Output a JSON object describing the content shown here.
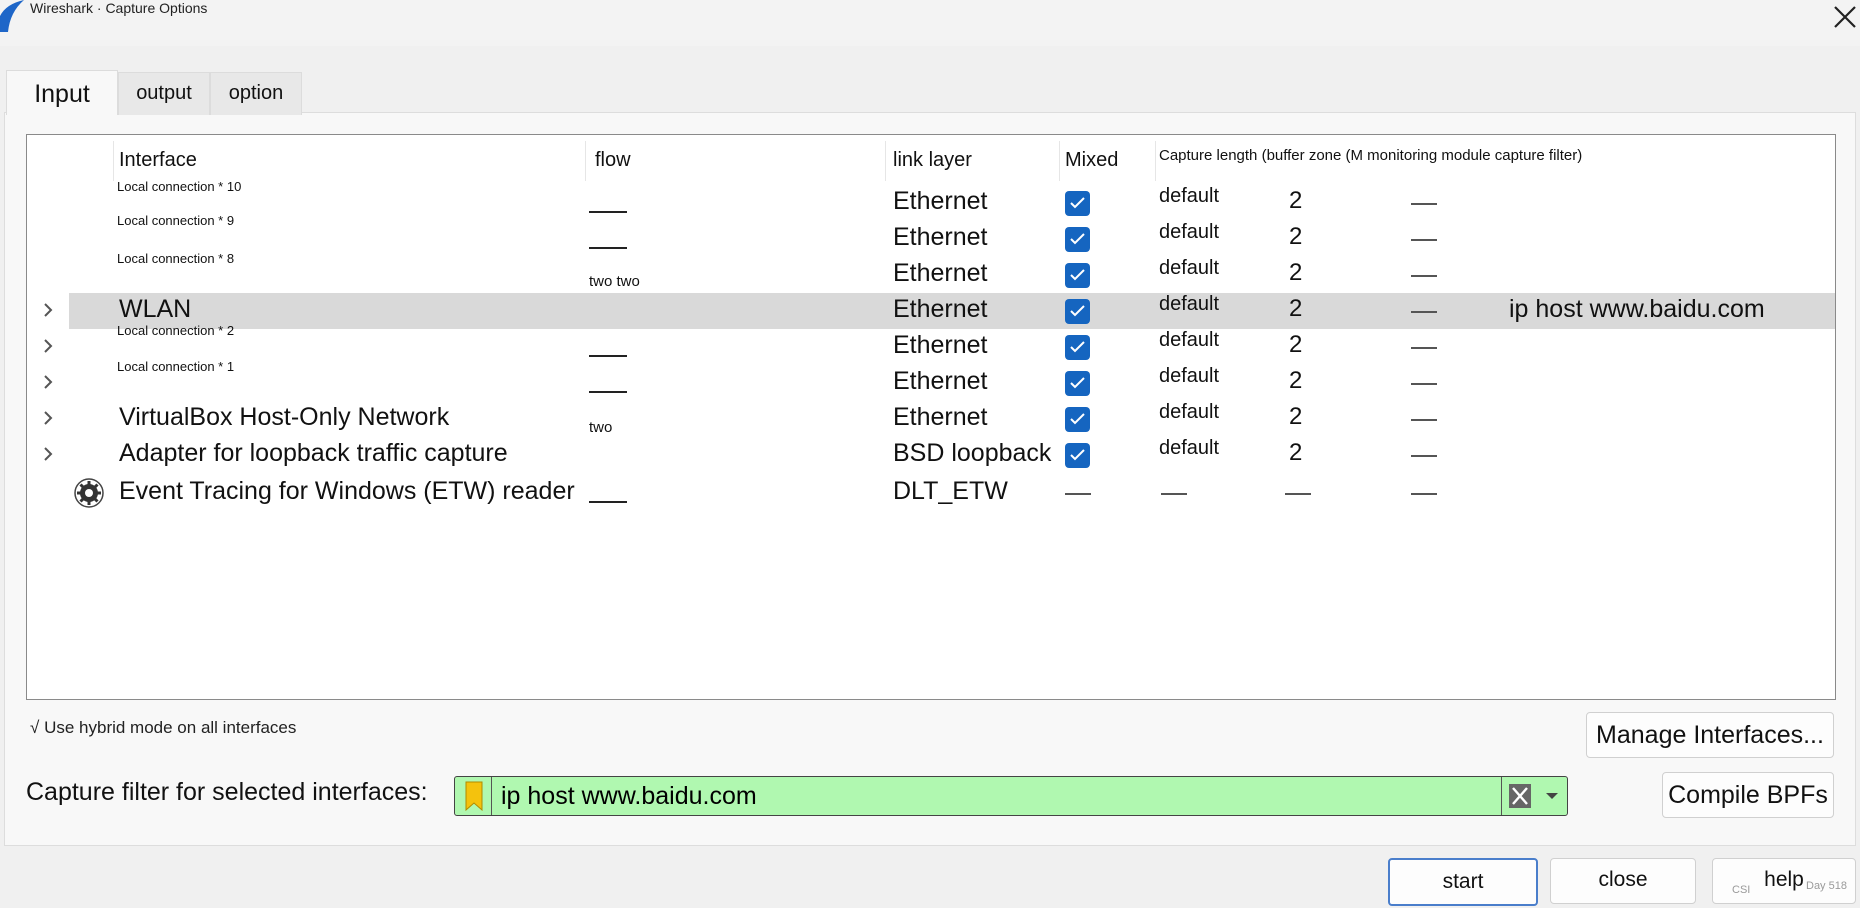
{
  "window": {
    "title": "Wireshark · Capture Options"
  },
  "tabs": [
    {
      "label": "Input",
      "active": true
    },
    {
      "label": "output",
      "active": false
    },
    {
      "label": "option",
      "active": false
    }
  ],
  "columns": {
    "interface": "Interface",
    "flow": "flow",
    "link_layer": "link layer",
    "mixed": "Mixed",
    "rest": "Capture length (buffer zone (M monitoring module capture filter)"
  },
  "rows": [
    {
      "interface": "Local connection * 10",
      "flow": "",
      "link": "Ethernet",
      "length": "default",
      "buffer": "2",
      "filter": ""
    },
    {
      "interface": "Local connection * 9",
      "flow": "",
      "link": "Ethernet",
      "length": "default",
      "buffer": "2",
      "filter": ""
    },
    {
      "interface": "Local connection * 8",
      "flow": "two two",
      "link": "Ethernet",
      "length": "default",
      "buffer": "2",
      "filter": ""
    },
    {
      "interface": "WLAN",
      "flow": "",
      "link": "Ethernet",
      "length": "default",
      "buffer": "2",
      "filter": "ip host www.baidu.com"
    },
    {
      "interface": "Local connection * 2",
      "flow": "",
      "link": "Ethernet",
      "length": "default",
      "buffer": "2",
      "filter": ""
    },
    {
      "interface": "Local connection * 1",
      "flow": "",
      "link": "Ethernet",
      "length": "default",
      "buffer": "2",
      "filter": ""
    },
    {
      "interface": "VirtualBox Host-Only Network",
      "flow": "two",
      "link": "Ethernet",
      "length": "default",
      "buffer": "2",
      "filter": ""
    },
    {
      "interface": "Adapter for loopback traffic capture",
      "flow": "",
      "link": "BSD loopback",
      "length": "default",
      "buffer": "2",
      "filter": ""
    },
    {
      "interface": "Event Tracing for Windows (ETW) reader",
      "flow": "",
      "link": "DLT_ETW",
      "length": "",
      "buffer": "",
      "filter": ""
    }
  ],
  "hybrid_mode": {
    "check": "√",
    "label": "Use hybrid mode on all interfaces"
  },
  "buttons": {
    "manage": "Manage Interfaces...",
    "compile": "Compile BPFs",
    "start": "start",
    "close": "close",
    "help": "help"
  },
  "capture_filter": {
    "label": "Capture filter for selected interfaces:",
    "value": "ip host www.baidu.com"
  },
  "footer": {
    "left": "CSI",
    "right": "Day 518"
  },
  "colors": {
    "accent": "#1565c0",
    "filter_valid": "#b0f8b0",
    "selected_row": "#d9d9d9"
  }
}
